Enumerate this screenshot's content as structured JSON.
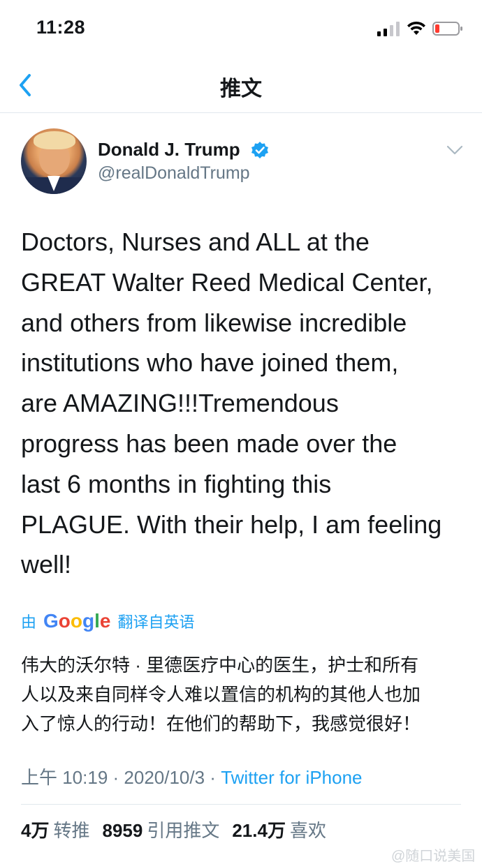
{
  "status_bar": {
    "time": "11:28",
    "signal_icon": "cellular-signal-icon",
    "wifi_icon": "wifi-icon",
    "battery_icon": "battery-low-icon",
    "battery_color": "#ff3b30"
  },
  "nav": {
    "back_icon": "chevron-left-icon",
    "title": "推文"
  },
  "tweet": {
    "author": {
      "display_name": "Donald J. Trump",
      "handle": "@realDonaldTrump",
      "verified": true
    },
    "text": "Doctors, Nurses and ALL at the\nGREAT Walter Reed Medical Center,\nand others from likewise incredible\ninstitutions who have joined them,\nare AMAZING!!!Tremendous\nprogress has been made over the\nlast 6 months in fighting this\nPLAGUE. With their help, I am feeling\nwell!",
    "translation": {
      "by": "由",
      "provider": [
        "G",
        "o",
        "o",
        "g",
        "l",
        "e"
      ],
      "from": "翻译自英语",
      "text": "伟大的沃尔特 · 里德医疗中心的医生，护士和所有\n人以及来自同样令人难以置信的机构的其他人也加\n入了惊人的行动！在他们的帮助下，我感觉很好！"
    },
    "meta": {
      "time": "上午 10:19",
      "separator": " · ",
      "date": "2020/10/3",
      "source": "Twitter for iPhone"
    },
    "stats": [
      {
        "value": "4万",
        "label": "转推"
      },
      {
        "value": "8959",
        "label": "引用推文"
      },
      {
        "value": "21.4万",
        "label": "喜欢"
      }
    ]
  },
  "watermark": "@随口说美国",
  "colors": {
    "accent": "#1da1f2",
    "text": "#14171a",
    "muted": "#657786",
    "divider": "#e1e8ed"
  }
}
